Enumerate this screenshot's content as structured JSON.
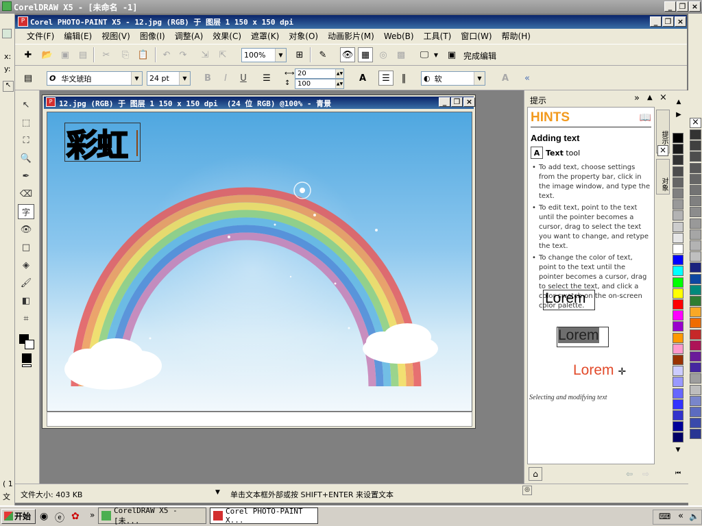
{
  "outer_title": "CorelDRAW X5 - [未命名 -1]",
  "app_title": "Corel PHOTO-PAINT X5 - 12.jpg (RGB) 于 图层 1 150 x 150 dpi",
  "menu": [
    "文件(F)",
    "编辑(E)",
    "视图(V)",
    "图像(I)",
    "调整(A)",
    "效果(C)",
    "遮罩(K)",
    "对象(O)",
    "动画影片(M)",
    "Web(B)",
    "工具(T)",
    "窗口(W)",
    "帮助(H)"
  ],
  "toolbar": {
    "zoom": "100%",
    "finish_label": "完成编辑"
  },
  "property_bar": {
    "font_name": "华文琥珀",
    "font_size": "24 pt",
    "spacing": "20",
    "line_spacing": "100",
    "antialias": "软"
  },
  "left_coords": {
    "x": "x:",
    "y": "y:"
  },
  "doc_window": {
    "title": "12.jpg (RGB) 于 图层 1 150 x 150 dpi  (24 位 RGB) @100% - 青景",
    "text": "彩虹"
  },
  "hints": {
    "panel_title": "提示",
    "header": "HINTS",
    "section": "Adding text",
    "tool_name": "Text",
    "tool_suffix": "tool",
    "bullets": [
      "To add text, choose settings from the property bar, click in the image window, and type the text.",
      "To edit text, point to the text until the pointer becomes a cursor, drag to select the text you want to change, and retype the text.",
      "To change the color of text, point to the text until the pointer becomes a cursor, drag to select the text, and click a color swatch on the on-screen color palette."
    ],
    "sample1": "Lorem",
    "sample2_sel": "Lorem",
    "sample3_a": "Lorem",
    "sample3_b": "m",
    "caption": "Selecting and modifying text",
    "side_tab_1": "提示",
    "side_tab_2": "对象"
  },
  "status": {
    "filesize": "文件大小: 403 KB",
    "message": "单击文本框外部或按 SHIFT+ENTER 来设置文本"
  },
  "taskbar": {
    "start": "开始",
    "task1": "CorelDRAW X5 - [未...",
    "task2": "Corel PHOTO-PAINT X..."
  },
  "left_edge": {
    "label1": "( 1",
    "label2": "文"
  },
  "palette_colors": [
    "#000000",
    "#1a1a1a",
    "#333333",
    "#4d4d4d",
    "#666666",
    "#808080",
    "#999999",
    "#b3b3b3",
    "#cccccc",
    "#e6e6e6",
    "#ffffff",
    "#0000ff",
    "#00ffff",
    "#00ff00",
    "#ffff00",
    "#ff0000",
    "#ff00ff",
    "#9900cc",
    "#ff9900",
    "#ff99cc",
    "#993300",
    "#ccccff",
    "#9999ff",
    "#6666ff",
    "#3333ff",
    "#3333cc",
    "#000099",
    "#000066"
  ],
  "palette_colors_2": [
    "#333333",
    "#404040",
    "#4d4d4d",
    "#595959",
    "#666666",
    "#737373",
    "#808080",
    "#8c8c8c",
    "#999999",
    "#a6a6a6",
    "#b3b3b3",
    "#bfbfbf",
    "#1a237e",
    "#0d47a1",
    "#00897b",
    "#2e7d32",
    "#f9a825",
    "#ef6c00",
    "#c62828",
    "#ad1457",
    "#6a1b9a",
    "#4527a0",
    "#9e9e9e",
    "#bdbdbd",
    "#7986cb",
    "#5c6bc0",
    "#3949ab",
    "#283593"
  ]
}
